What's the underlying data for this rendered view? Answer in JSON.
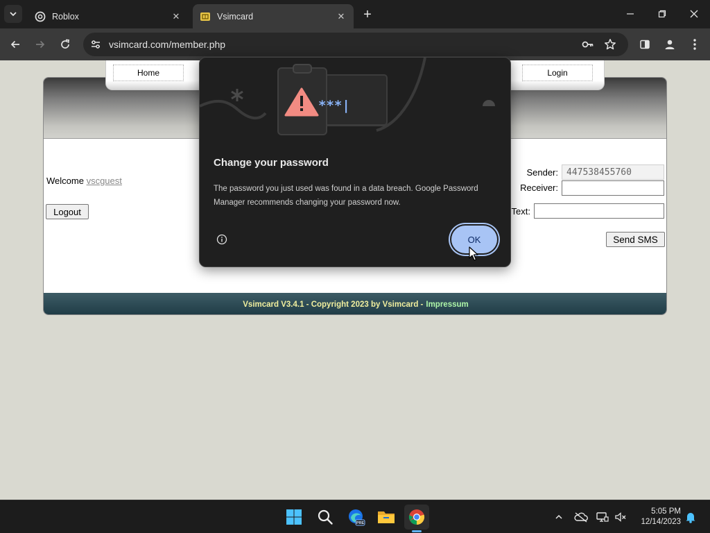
{
  "browser": {
    "tabs": [
      {
        "title": "Roblox",
        "icon": "roblox-icon",
        "active": false
      },
      {
        "title": "Vsimcard",
        "icon": "sim-card-icon",
        "active": true
      }
    ],
    "url": "vsimcard.com/member.php"
  },
  "page": {
    "nav": {
      "home_label": "Home",
      "login_label": "Login"
    },
    "welcome_prefix": "Welcome",
    "username": "vscguest",
    "logout_label": "Logout",
    "form": {
      "sender_label": "Sender:",
      "sender_value": "447538455760",
      "receiver_label": "Receiver:",
      "receiver_value": "",
      "text_label": "Text:",
      "text_value": "",
      "send_label": "Send SMS"
    },
    "footer": {
      "text": "Vsimcard V3.4.1 - Copyright 2023 by Vsimcard -",
      "link": "Impressum"
    }
  },
  "dialog": {
    "title": "Change your password",
    "body": "The password you just used was found in a data breach. Google Password Manager recommends changing your password now.",
    "ok_label": "OK",
    "art_password_mask": "***|",
    "accent_color": "#a8c4f5",
    "warning_color": "#f28b82"
  },
  "taskbar": {
    "apps": [
      "windows-start-icon",
      "search-icon",
      "edge-beta-icon",
      "file-explorer-icon",
      "chrome-icon"
    ],
    "time": "5:05 PM",
    "date": "12/14/2023"
  }
}
